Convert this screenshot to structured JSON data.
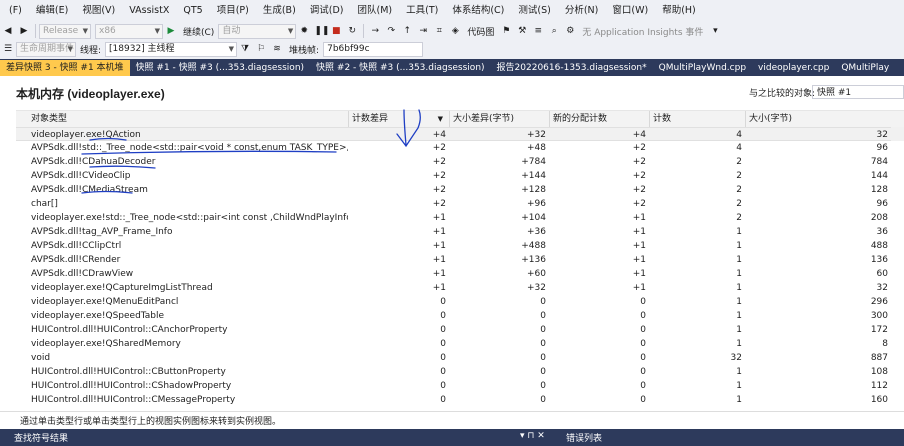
{
  "menu": [
    "(F)",
    "编辑(E)",
    "视图(V)",
    "VAssistX",
    "QT5",
    "项目(P)",
    "生成(B)",
    "调试(D)",
    "团队(M)",
    "工具(T)",
    "体系结构(C)",
    "测试(S)",
    "分析(N)",
    "窗口(W)",
    "帮助(H)"
  ],
  "toolbar": {
    "config": "Release",
    "platform": "x86",
    "continue": "继续(C)",
    "auto": "自动",
    "code_map": "代码图",
    "insights": "无 Application Insights 事件",
    "lifecycle": "生命周期事件",
    "thread_label": "线程:",
    "thread_value": "[18932] 主线程",
    "stack_label": "堆栈帧:",
    "stack_value": "7b6bf99c"
  },
  "tabs": [
    {
      "label": "差异快照 3 - 快照 #1 本机堆",
      "active": true
    },
    {
      "label": "快照 #1 - 快照 #3 (...353.diagsession)"
    },
    {
      "label": "快照 #2 - 快照 #3 (...353.diagsession)"
    },
    {
      "label": "报告20220616-1353.diagsession*"
    },
    {
      "label": "QMultiPlayWnd.cpp"
    },
    {
      "label": "videoplayer.cpp"
    },
    {
      "label": "QMultiPlay"
    }
  ],
  "page": {
    "title": "本机内存 (videoplayer.exe)",
    "compare_label": "与之比较的对象:",
    "compare_value": "快照 #1"
  },
  "table": {
    "headers": [
      "对象类型",
      "计数差异",
      "大小差异(字节)",
      "新的分配计数",
      "计数",
      "大小(字节)"
    ],
    "rows": [
      [
        "videoplayer.exe!QAction",
        "+4",
        "+32",
        "+4",
        "4",
        "32"
      ],
      [
        "AVPSdk.dll!std::_Tree_node<std::pair<void * const,enum TASK_TYPE>,void *>",
        "+2",
        "+48",
        "+2",
        "4",
        "96"
      ],
      [
        "AVPSdk.dll!CDahuaDecoder",
        "+2",
        "+784",
        "+2",
        "2",
        "784"
      ],
      [
        "AVPSdk.dll!CVideoClip",
        "+2",
        "+144",
        "+2",
        "2",
        "144"
      ],
      [
        "AVPSdk.dll!CMediaStream",
        "+2",
        "+128",
        "+2",
        "2",
        "128"
      ],
      [
        "char[]",
        "+2",
        "+96",
        "+2",
        "2",
        "96"
      ],
      [
        "videoplayer.exe!std::_Tree_node<std::pair<int const ,ChildWndPlayInfo>,void *>",
        "+1",
        "+104",
        "+1",
        "2",
        "208"
      ],
      [
        "AVPSdk.dll!tag_AVP_Frame_Info",
        "+1",
        "+36",
        "+1",
        "1",
        "36"
      ],
      [
        "AVPSdk.dll!CClipCtrl",
        "+1",
        "+488",
        "+1",
        "1",
        "488"
      ],
      [
        "AVPSdk.dll!CRender",
        "+1",
        "+136",
        "+1",
        "1",
        "136"
      ],
      [
        "AVPSdk.dll!CDrawView",
        "+1",
        "+60",
        "+1",
        "1",
        "60"
      ],
      [
        "videoplayer.exe!QCaptureImgListThread",
        "+1",
        "+32",
        "+1",
        "1",
        "32"
      ],
      [
        "videoplayer.exe!QMenuEditPancl",
        "0",
        "0",
        "0",
        "1",
        "296"
      ],
      [
        "videoplayer.exe!QSpeedTable",
        "0",
        "0",
        "0",
        "1",
        "300"
      ],
      [
        "HUIControl.dll!HUIControl::CAnchorProperty",
        "0",
        "0",
        "0",
        "1",
        "172"
      ],
      [
        "videoplayer.exe!QSharedMemory",
        "0",
        "0",
        "0",
        "1",
        "8"
      ],
      [
        "void",
        "0",
        "0",
        "0",
        "32",
        "887"
      ],
      [
        "HUIControl.dll!HUIControl::CButtonProperty",
        "0",
        "0",
        "0",
        "1",
        "108"
      ],
      [
        "HUIControl.dll!HUIControl::CShadowProperty",
        "0",
        "0",
        "0",
        "1",
        "112"
      ],
      [
        "HUIControl.dll!HUIControl::CMessageProperty",
        "0",
        "0",
        "0",
        "1",
        "160"
      ]
    ]
  },
  "status": "通过单击类型行或单击类型行上的视图实例图标来转到实例视图。",
  "bottom": {
    "left_panel": "查找符号结果",
    "right_panel": "错误列表"
  },
  "colors": {
    "tab_strip": "#2d3a5c",
    "active_tab": "#ffc94d",
    "annotation": "#1f3fc4"
  }
}
